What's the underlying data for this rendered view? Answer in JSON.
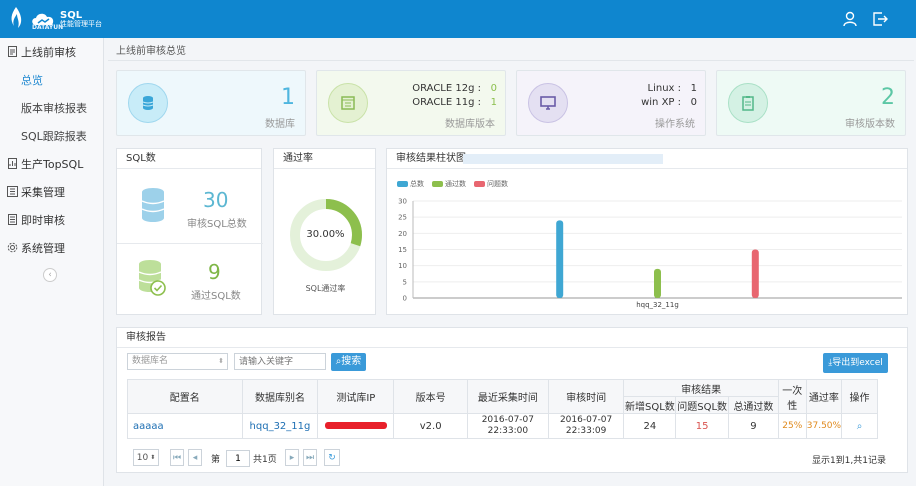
{
  "app": {
    "brand": "DATAYUN",
    "title_line1": "SQL",
    "title_line2": "性能管理平台"
  },
  "sidebar": {
    "items": [
      {
        "label": "上线前审核"
      },
      {
        "label": "总览"
      },
      {
        "label": "版本审核报表"
      },
      {
        "label": "SQL跟踪报表"
      },
      {
        "label": "生产TopSQL"
      },
      {
        "label": "采集管理"
      },
      {
        "label": "即时审核"
      },
      {
        "label": "系统管理"
      }
    ],
    "collapse_icon": "chevron-left-icon"
  },
  "breadcrumb": "上线前审核总览",
  "cards": {
    "db": {
      "value": "1",
      "label": "数据库"
    },
    "version": {
      "rows": [
        {
          "name": "ORACLE 12g :",
          "value": "0"
        },
        {
          "name": "ORACLE 11g :",
          "value": "1"
        }
      ],
      "label": "数据库版本"
    },
    "os": {
      "rows": [
        {
          "name": "Linux :",
          "value": "1"
        },
        {
          "name": "win XP :",
          "value": "0"
        }
      ],
      "label": "操作系统"
    },
    "audit": {
      "value": "2",
      "label": "审核版本数"
    }
  },
  "sql_panel": {
    "title": "SQL数",
    "total_value": "30",
    "total_label": "审核SQL总数",
    "pass_value": "9",
    "pass_label": "通过SQL数"
  },
  "pass_panel": {
    "title": "通过率",
    "percent_label": "30.00%",
    "percent": 0.3,
    "caption": "SQL通过率"
  },
  "chart_panel": {
    "title": "审核结果柱状图"
  },
  "chart_data": {
    "type": "bar",
    "categories": [
      "hqq_32_11g"
    ],
    "series": [
      {
        "name": "总数",
        "values": [
          24
        ],
        "color": "#3fa7d3"
      },
      {
        "name": "通过数",
        "values": [
          9
        ],
        "color": "#8dbf4d"
      },
      {
        "name": "问题数",
        "values": [
          15
        ],
        "color": "#e86670"
      }
    ],
    "ylim": [
      0,
      30
    ],
    "yticks": [
      "0",
      "5",
      "10",
      "15",
      "20",
      "25",
      "30"
    ],
    "legend": "top-left"
  },
  "report": {
    "title": "审核报告",
    "db_select": "数据库名",
    "keyword_placeholder": "请输入关键字",
    "search_label": "搜索",
    "export_label": "导出到excel",
    "headers": {
      "config": "配置名",
      "alias": "数据库别名",
      "ip": "测试库IP",
      "version": "版本号",
      "collect": "最近采集时间",
      "audit_time": "审核时间",
      "result": "审核结果",
      "new_sql": "新增SQL数",
      "problem_sql": "问题SQL数",
      "total_pass": "总通过数",
      "first_pass": "一次性",
      "pass_rate": "通过率",
      "action": "操作"
    },
    "rows": [
      {
        "config": "aaaaa",
        "alias": "hqq_32_11g",
        "version": "v2.0",
        "collect_date": "2016-07-07",
        "collect_time": "22:33:00",
        "audit_date": "2016-07-07",
        "audit_time": "22:33:09",
        "new_sql": "24",
        "problem_sql": "15",
        "total_pass": "9",
        "first_pass": "25%",
        "pass_rate": "37.50%"
      }
    ],
    "page_size": "10",
    "page_prefix": "第",
    "page_value": "1",
    "page_suffix": "共1页",
    "summary": "显示1到1,共1记录"
  }
}
